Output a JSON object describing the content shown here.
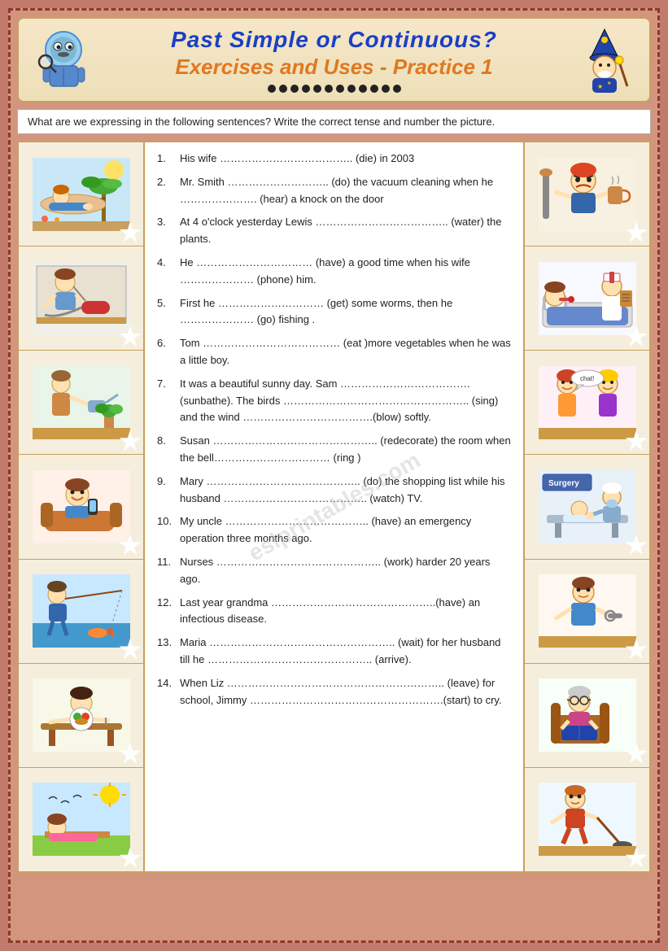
{
  "header": {
    "title": "Past  Simple or Continuous?",
    "subtitle": "Exercises and Uses - Practice 1",
    "icon_left": "🔍",
    "icon_right": "🧙"
  },
  "instruction": "What are we expressing in the following sentences?  Write the correct tense and number the picture.",
  "exercises": [
    {
      "number": "1.",
      "text": "His wife ……………………………….. (die) in 2003"
    },
    {
      "number": "2.",
      "text": "Mr. Smith ……………………….. (do)  the vacuum cleaning when he ………………… (hear)  a knock on the door"
    },
    {
      "number": "3.",
      "text": "At  4 o'clock yesterday  Lewis ……………………………….. (water)  the plants."
    },
    {
      "number": "4.",
      "text": "He ……………………………. (have)  a good time when his wife ………………… (phone)  him."
    },
    {
      "number": "5.",
      "text": "First he …………………………….. (get) some worms, then he ………………… (go) fishing ."
    },
    {
      "number": "6.",
      "text": "Tom ………………………………… (eat )more  vegetables when he was a little boy."
    },
    {
      "number": "7.",
      "text": "It was a beautiful  sunny day. Sam …………………………… (sunbathe). The birds ……………………………………….. (sing)  and the wind ………………………………….(blow)  softly."
    },
    {
      "number": "8.",
      "text": "Susan ……………………………………….. (redecorate) the room  when the bell…………………………… (ring )"
    },
    {
      "number": "9.",
      "text": "Mary …………………………………….. (do) the shopping list while his husband ………………………………….. (watch) TV."
    },
    {
      "number": "10.",
      "text": "My uncle ………………………………….. (have) an emergency operation three months ago."
    },
    {
      "number": "11.",
      "text": "Nurses  ……………………………………….. (work)  harder 20 years ago."
    },
    {
      "number": "12.",
      "text": "Last year grandma ………………………………………..(have)  an infectious disease."
    },
    {
      "number": "13.",
      "text": "Maria  ……………………………………………..  (wait)  for her husband till he ……………………………………….. (arrive)."
    },
    {
      "number": "14.",
      "text": "When  Liz …………………………………………………….. (leave) for school, Jimmy ……………………………………………….(start)  to cry."
    }
  ],
  "left_images": [
    {
      "emoji": "🏖️🧑",
      "label": "person relaxing"
    },
    {
      "emoji": "🚿🧹",
      "label": "vacuum cleaning"
    },
    {
      "emoji": "🌱💧",
      "label": "watering plants"
    },
    {
      "emoji": "🎮😊",
      "label": "having good time"
    },
    {
      "emoji": "🎣🐛",
      "label": "fishing worms"
    },
    {
      "emoji": "🥦👦",
      "label": "eating vegetables"
    },
    {
      "emoji": "☀️🌤️",
      "label": "sunny day"
    }
  ],
  "right_images": [
    {
      "emoji": "😤🧹",
      "label": "angry person"
    },
    {
      "emoji": "🛏️👩‍⚕️",
      "label": "sick person"
    },
    {
      "emoji": "👧👧",
      "label": "two girls"
    },
    {
      "emoji": "🏥🩺",
      "label": "surgery"
    },
    {
      "emoji": "🔧💼",
      "label": "worker"
    },
    {
      "emoji": "👩📚",
      "label": "grandma"
    },
    {
      "emoji": "🧹🧽",
      "label": "cleaning"
    }
  ],
  "watermark": "eslprintables.com"
}
